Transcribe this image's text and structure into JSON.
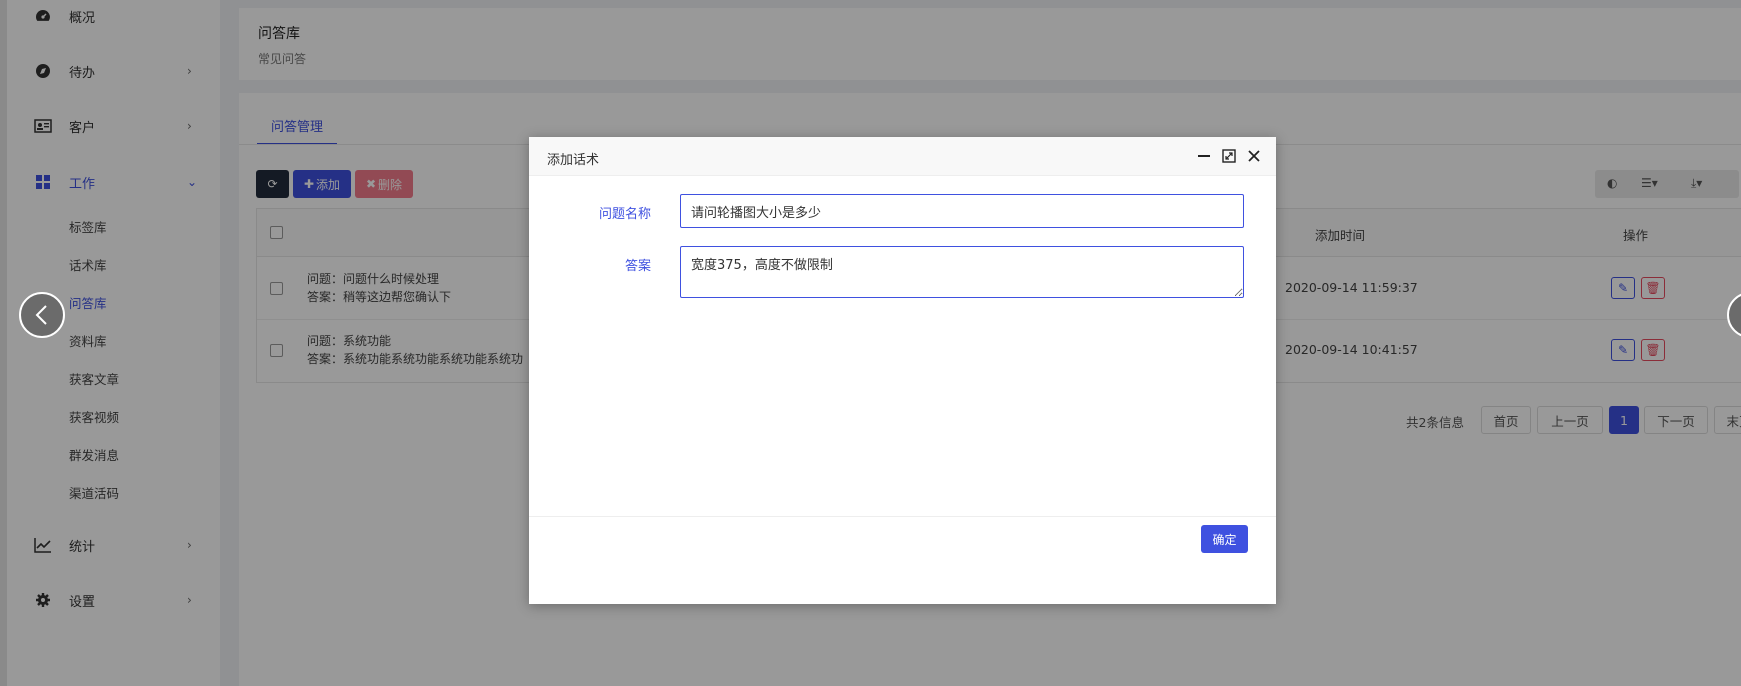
{
  "sidebar": {
    "items": [
      {
        "label": "概况",
        "icon": "dashboard-icon"
      },
      {
        "label": "待办",
        "icon": "compass-icon"
      },
      {
        "label": "客户",
        "icon": "contact-card-icon"
      },
      {
        "label": "工作",
        "icon": "grid-icon"
      },
      {
        "label": "统计",
        "icon": "line-chart-icon"
      },
      {
        "label": "设置",
        "icon": "gear-icon"
      }
    ],
    "sub_items": [
      "标签库",
      "话术库",
      "问答库",
      "资料库",
      "获客文章",
      "获客视频",
      "群发消息",
      "渠道活码"
    ]
  },
  "header": {
    "title": "问答库",
    "subtitle": "常见问答"
  },
  "tabs": [
    {
      "label": "问答管理"
    }
  ],
  "toolbar": {
    "add_label": "添加",
    "delete_label": "删除"
  },
  "table": {
    "columns": {
      "time": "添加时间",
      "actions": "操作"
    },
    "rows": [
      {
        "question": "问题：问题什么时候处理",
        "answer": "答案：稍等这边帮您确认下",
        "time": "2020-09-14 11:59:37"
      },
      {
        "question": "问题：系统功能",
        "answer": "答案：系统功能系统功能系统功能系统功",
        "time": "2020-09-14 10:41:57"
      }
    ]
  },
  "pagination": {
    "info": "共2条信息",
    "first": "首页",
    "prev": "上一页",
    "current": "1",
    "next": "下一页",
    "last": "末页"
  },
  "modal": {
    "title": "添加话术",
    "question_label": "问题名称",
    "question_value": "请问轮播图大小是多少",
    "answer_label": "答案",
    "answer_value": "宽度375，高度不做限制",
    "confirm_label": "确定"
  },
  "colors": {
    "accent": "#3f51e0",
    "danger": "#e84b5f",
    "dark": "#222c3c"
  }
}
